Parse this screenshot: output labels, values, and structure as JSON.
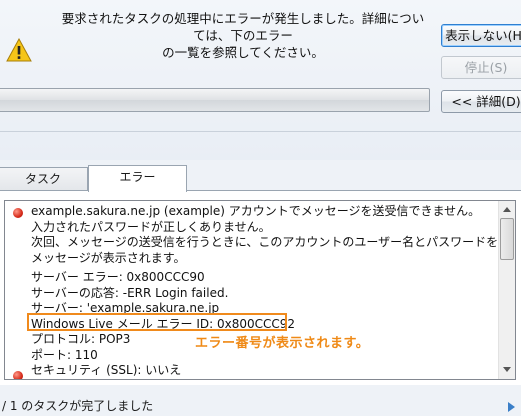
{
  "header": {
    "message_line1": "要求されたタスクの処理中にエラーが発生しました。詳細については、下のエラー",
    "message_line2": "の一覧を参照してください。"
  },
  "buttons": {
    "hide": "表示しない(H)",
    "stop": "停止(S)",
    "details": "<< 詳細(D)"
  },
  "tabs": [
    "タスク",
    "エラー"
  ],
  "error": {
    "lines": [
      "example.sakura.ne.jp (example) アカウントでメッセージを送受信できません。",
      "入力されたパスワードが正しくありません。",
      "次回、メッセージの送受信を行うときに、このアカウントのユーザー名とパスワードを入力するよう",
      "メッセージが表示されます。"
    ],
    "details": [
      "サーバー エラー: 0x800CCC90",
      "サーバーの応答: -ERR Login failed.",
      "サーバー: 'example.sakura.ne.jp",
      "Windows Live メール エラー ID: 0x800CCC92",
      "プロトコル: POP3",
      "ポート: 110",
      "セキュリティ (SSL): いいえ"
    ]
  },
  "annotation": "エラー番号が表示されます。",
  "status": "/ 1 のタスクが完了しました",
  "colors": {
    "annotation": "#ef8a17",
    "error_dot": "#d62a1a"
  }
}
